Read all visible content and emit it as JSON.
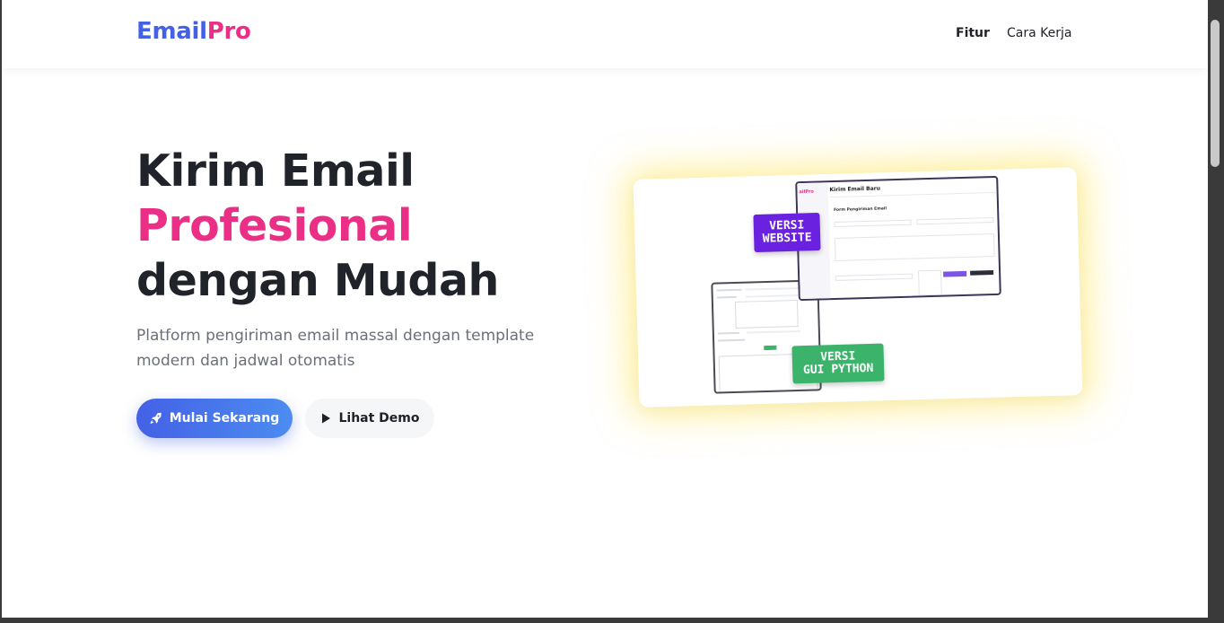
{
  "brand": {
    "part1": "Email",
    "part2": "Pro"
  },
  "nav": {
    "items": [
      "Fitur",
      "Cara Kerja"
    ]
  },
  "hero": {
    "title_line1": "Kirim Email",
    "title_line2": "Profesional",
    "title_line3": "dengan Mudah",
    "subtitle": "Platform pengiriman email massal dengan template modern dan jadwal otomatis",
    "primary_button": "Mulai Sekarang",
    "secondary_button": "Lihat Demo"
  },
  "illustration": {
    "tag_web_line1": "VERSI",
    "tag_web_line2": "WEBSITE",
    "tag_gui_line1": "VERSI",
    "tag_gui_line2": "GUI PYTHON",
    "web_window_title": "Kirim Email Baru",
    "web_form_heading": "Form Pengiriman Email"
  },
  "colors": {
    "brand_blue": "#4461e6",
    "brand_pink": "#ec2f86",
    "tag_web": "#6b21e0",
    "tag_gui": "#3bb36a",
    "glow": "#ffe24a"
  },
  "icons": {
    "primary_button": "rocket-icon",
    "secondary_button": "play-icon"
  }
}
